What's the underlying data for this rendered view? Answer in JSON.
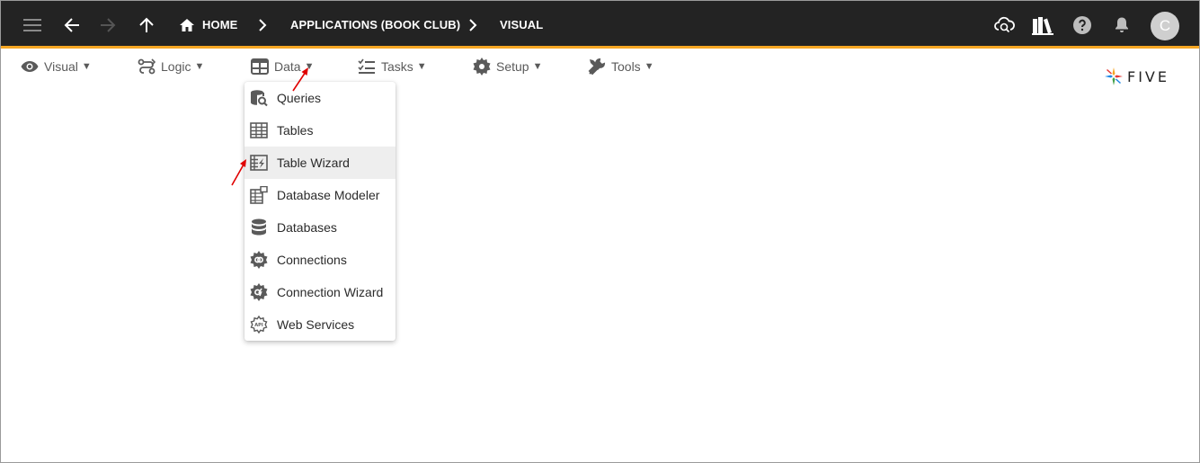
{
  "breadcrumbs": [
    "HOME",
    "APPLICATIONS (BOOK CLUB)",
    "VISUAL"
  ],
  "menu": [
    {
      "label": "Visual",
      "icon": "eye-icon"
    },
    {
      "label": "Logic",
      "icon": "logic-flow-icon"
    },
    {
      "label": "Data",
      "icon": "table-grid-icon"
    },
    {
      "label": "Tasks",
      "icon": "checklist-icon"
    },
    {
      "label": "Setup",
      "icon": "gear-icon"
    },
    {
      "label": "Tools",
      "icon": "tools-icon"
    }
  ],
  "menu_caret": "▼",
  "data_menu_items": [
    {
      "label": "Queries",
      "icon": "database-search-icon"
    },
    {
      "label": "Tables",
      "icon": "table-icon"
    },
    {
      "label": "Table Wizard",
      "icon": "table-wizard-icon",
      "highlighted": true
    },
    {
      "label": "Database Modeler",
      "icon": "database-modeler-icon"
    },
    {
      "label": "Databases",
      "icon": "database-icon"
    },
    {
      "label": "Connections",
      "icon": "connections-icon"
    },
    {
      "label": "Connection Wizard",
      "icon": "connection-wizard-icon"
    },
    {
      "label": "Web Services",
      "icon": "web-services-api-icon"
    }
  ],
  "user": {
    "avatar_initial": "C"
  },
  "logo": {
    "text": "FIVE"
  },
  "colors": {
    "appbar": "#232323",
    "accent": "#f5a623",
    "annotation_arrow": "#e00000"
  }
}
